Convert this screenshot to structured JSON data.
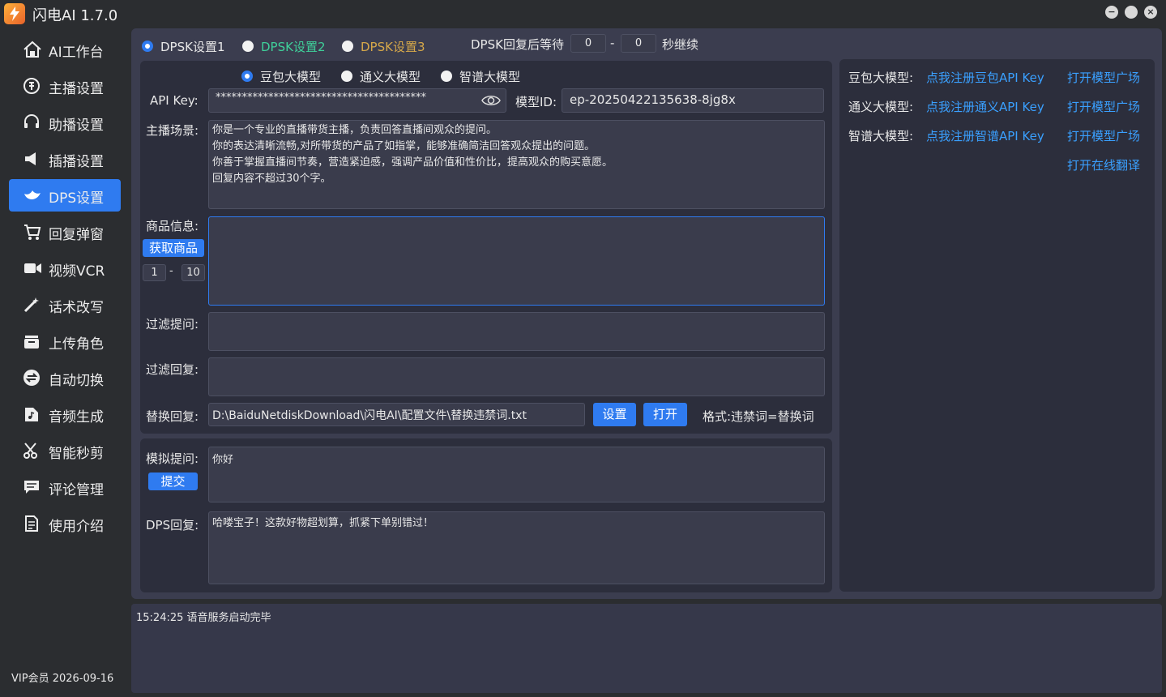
{
  "app": {
    "title": "闪电AI 1.7.0"
  },
  "window_controls": [
    "minimize",
    "maximize",
    "close"
  ],
  "sidebar": {
    "items": [
      {
        "label": "AI工作台",
        "icon": "home-icon"
      },
      {
        "label": "主播设置",
        "icon": "coin-icon"
      },
      {
        "label": "助播设置",
        "icon": "headset-icon"
      },
      {
        "label": "插播设置",
        "icon": "speaker-icon"
      },
      {
        "label": "DPS设置",
        "icon": "whale-icon",
        "active": true
      },
      {
        "label": "回复弹窗",
        "icon": "cart-icon"
      },
      {
        "label": "视频VCR",
        "icon": "video-icon"
      },
      {
        "label": "话术改写",
        "icon": "magic-wand-icon"
      },
      {
        "label": "上传角色",
        "icon": "inbox-icon"
      },
      {
        "label": "自动切换",
        "icon": "switch-icon"
      },
      {
        "label": "音频生成",
        "icon": "music-file-icon"
      },
      {
        "label": "智能秒剪",
        "icon": "scissors-icon"
      },
      {
        "label": "评论管理",
        "icon": "comment-icon"
      },
      {
        "label": "使用介绍",
        "icon": "document-icon"
      }
    ],
    "vip_text": "VIP会员  2026-09-16"
  },
  "settings_tabs": [
    {
      "label": "DPSK设置1",
      "selected": true
    },
    {
      "label": "DPSK设置2",
      "selected": false
    },
    {
      "label": "DPSK设置3",
      "selected": false
    }
  ],
  "wait": {
    "label": "DPSK回复后等待",
    "min": "0",
    "sep": "-",
    "max": "0",
    "suffix": "秒继续"
  },
  "models": [
    {
      "label": "豆包大模型",
      "selected": true
    },
    {
      "label": "通义大模型",
      "selected": false
    },
    {
      "label": "智谱大模型",
      "selected": false
    }
  ],
  "form": {
    "api_key_label": "API Key:",
    "api_key_value": "****************************************",
    "model_id_label": "模型ID:",
    "model_id_value": "ep-20250422135638-8jg8x",
    "scene_label": "主播场景:",
    "scene_text": "你是一个专业的直播带货主播，负责回答直播间观众的提问。\n你的表达清晰流畅,对所带货的产品了如指掌，能够准确简洁回答观众提出的问题。\n你善于掌握直播间节奏，营造紧迫感，强调产品价值和性价比，提高观众的购买意愿。\n回复内容不超过30个字。",
    "product_label": "商品信息:",
    "fetch_button": "获取商品",
    "range_from": "1",
    "range_sep": "-",
    "range_to": "10",
    "product_text": "",
    "filter_q_label": "过滤提问:",
    "filter_q_text": "",
    "filter_r_label": "过滤回复:",
    "filter_r_text": "",
    "replace_label": "替换回复:",
    "replace_path": "D:\\BaiduNetdiskDownload\\闪电AI\\配置文件\\替换违禁词.txt",
    "set_button": "设置",
    "open_button": "打开",
    "format_hint": "格式:违禁词=替换词"
  },
  "simulate": {
    "question_label": "模拟提问:",
    "question_text": "你好",
    "submit_button": "提交",
    "reply_label": "DPS回复:",
    "reply_text": "哈喽宝子！这款好物超划算，抓紧下单别错过！"
  },
  "right_panel": {
    "rows": [
      {
        "label": "豆包大模型:",
        "link": "点我注册豆包API Key",
        "open": "打开模型广场"
      },
      {
        "label": "通义大模型:",
        "link": "点我注册通义API Key",
        "open": "打开模型广场"
      },
      {
        "label": "智谱大模型:",
        "link": "点我注册智谱API Key",
        "open": "打开模型广场"
      }
    ],
    "translate_link": "打开在线翻译"
  },
  "log": {
    "lines": [
      "15:24:25 语音服务启动完毕"
    ]
  },
  "colors": {
    "accent": "#2f7bf0",
    "link": "#3aa0ff",
    "tab2": "#3fd09a",
    "tab3": "#d6a84a"
  }
}
